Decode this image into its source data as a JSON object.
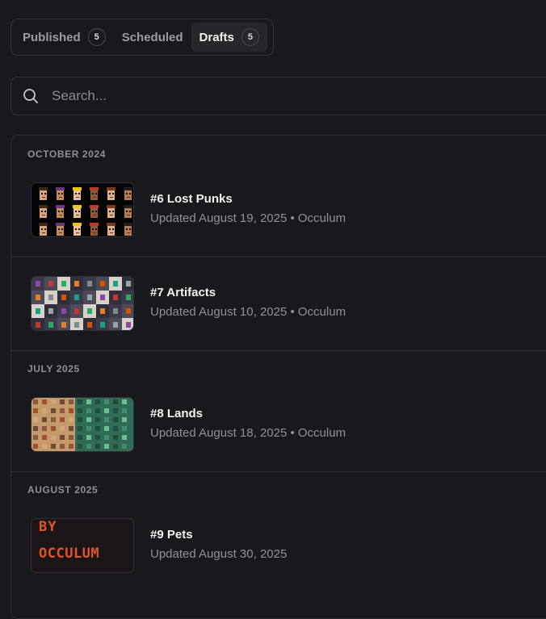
{
  "tabs": [
    {
      "label": "Published",
      "count": "5"
    },
    {
      "label": "Scheduled"
    },
    {
      "label": "Drafts",
      "count": "5"
    }
  ],
  "search": {
    "placeholder": "Search..."
  },
  "groups": [
    {
      "heading": "OCTOBER 2024"
    },
    {
      "heading": "JULY 2025"
    },
    {
      "heading": "AUGUST 2025"
    }
  ],
  "drafts": [
    {
      "title": "#6 Lost Punks",
      "meta": "Updated August 19, 2025 • Occulum"
    },
    {
      "title": "#7 Artifacts",
      "meta": "Updated August 10, 2025 • Occulum"
    },
    {
      "title": "#8 Lands",
      "meta": "Updated August 18, 2025 • Occulum"
    },
    {
      "title": "#9 Pets",
      "meta": "Updated August 30, 2025"
    }
  ],
  "thumbnails": {
    "pets_text_line1": "BY",
    "pets_text_line2": "OCCULUM"
  },
  "colors": {
    "background": "#18191c",
    "pets_text": "#e0542a"
  }
}
